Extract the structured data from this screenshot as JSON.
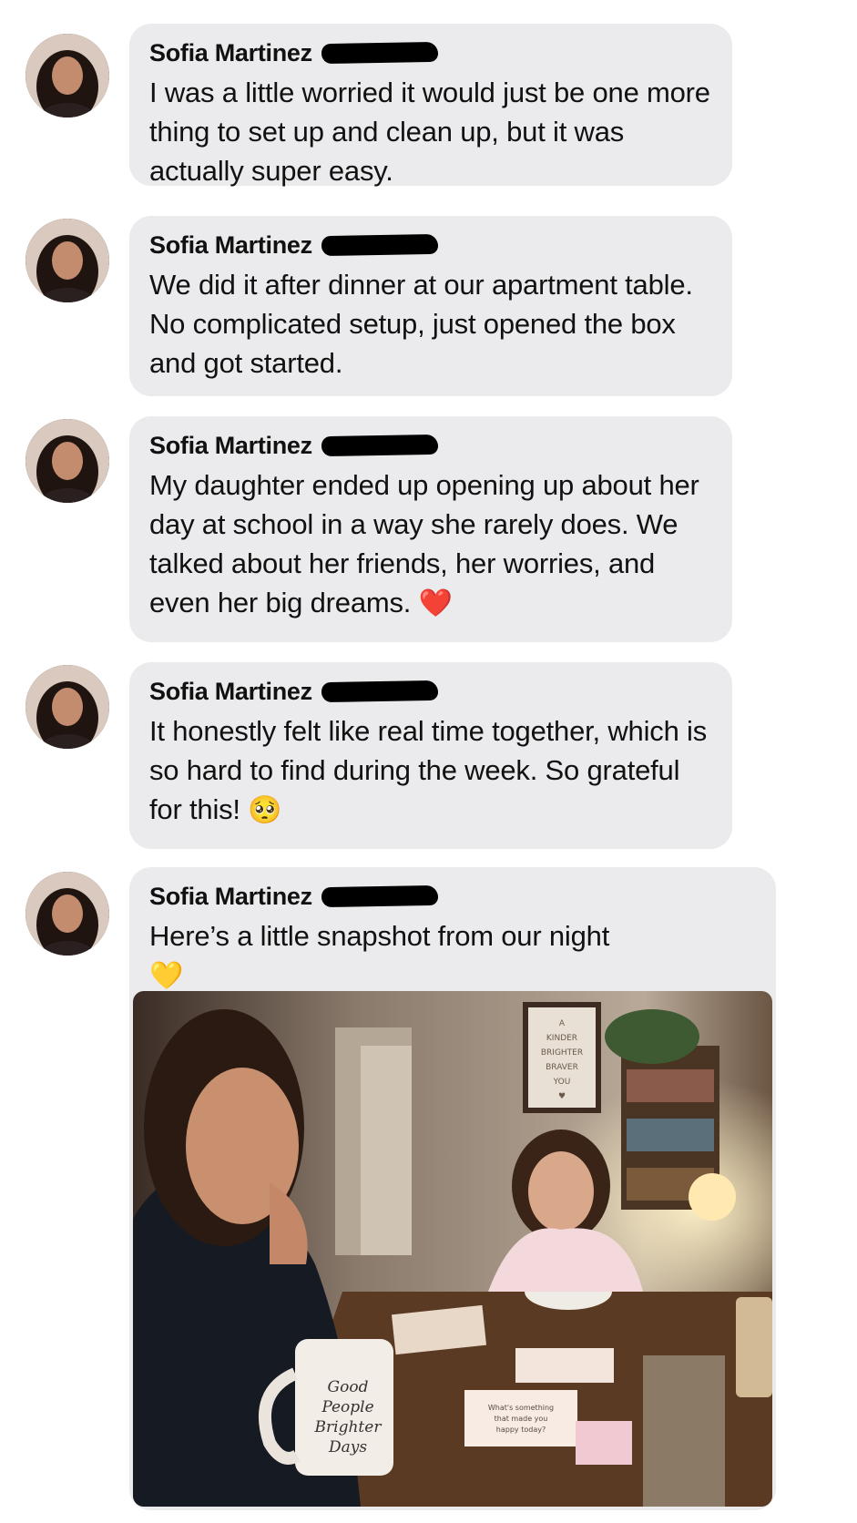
{
  "messages": [
    {
      "sender": "Sofia Martinez",
      "text": "I was a little worried it would just be one more thing to set up and clean up, but it was actually super easy."
    },
    {
      "sender": "Sofia Martinez",
      "text": "We did it after dinner at our apartment table. No complicated setup, just opened the box and got started."
    },
    {
      "sender": "Sofia Martinez",
      "text": "My daughter ended up opening up about her day at school in a way she rarely does. We talked about her friends, her worries, and even her big dreams.",
      "emoji": "❤️"
    },
    {
      "sender": "Sofia Martinez",
      "text": "It honestly felt like real time together, which is so hard to find during the week. So grateful for this!",
      "emoji": "🥺"
    },
    {
      "sender": "Sofia Martinez",
      "text": "Here’s a little snapshot from our night",
      "emoji": "💛"
    }
  ],
  "photo": {
    "poster_text": [
      "A",
      "KINDER",
      "BRIGHTER",
      "BRAVER",
      "YOU",
      "♥"
    ],
    "mug_text": [
      "Good",
      "People",
      "Brighter",
      "Days"
    ],
    "card_text": [
      "What's something",
      "that made you",
      "happy today?"
    ]
  }
}
